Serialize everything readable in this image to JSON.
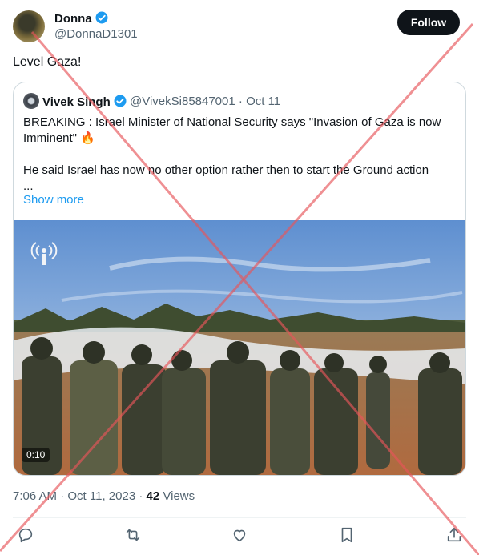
{
  "tweet": {
    "author_name": "Donna",
    "author_handle": "@DonnaD1301",
    "follow_label": "Follow",
    "text": "Level Gaza!",
    "time": "7:06 AM",
    "date": "Oct 11, 2023",
    "views_count": "42",
    "views_label": "Views"
  },
  "quote": {
    "author_name": "Vivek Singh",
    "author_handle": "@VivekSi85847001",
    "date": "Oct 11",
    "line1": "BREAKING : Israel Minister of National Security says \"Invasion of Gaza is now Imminent\" 🔥",
    "line2": "He said Israel has now no other option rather then to start the Ground action",
    "line3": "...",
    "show_more": "Show more",
    "video_duration": "0:10"
  },
  "icons": {
    "verified": "verified-badge-icon",
    "reply": "reply-icon",
    "retweet": "retweet-icon",
    "like": "like-icon",
    "bookmark": "bookmark-icon",
    "share": "share-icon",
    "overlay": "red-x-overlay"
  },
  "colors": {
    "verified": "#1d9bf0",
    "link": "#1d9bf0",
    "overlay": "#e8555a",
    "text": "#0f1419",
    "secondary": "#536471"
  }
}
